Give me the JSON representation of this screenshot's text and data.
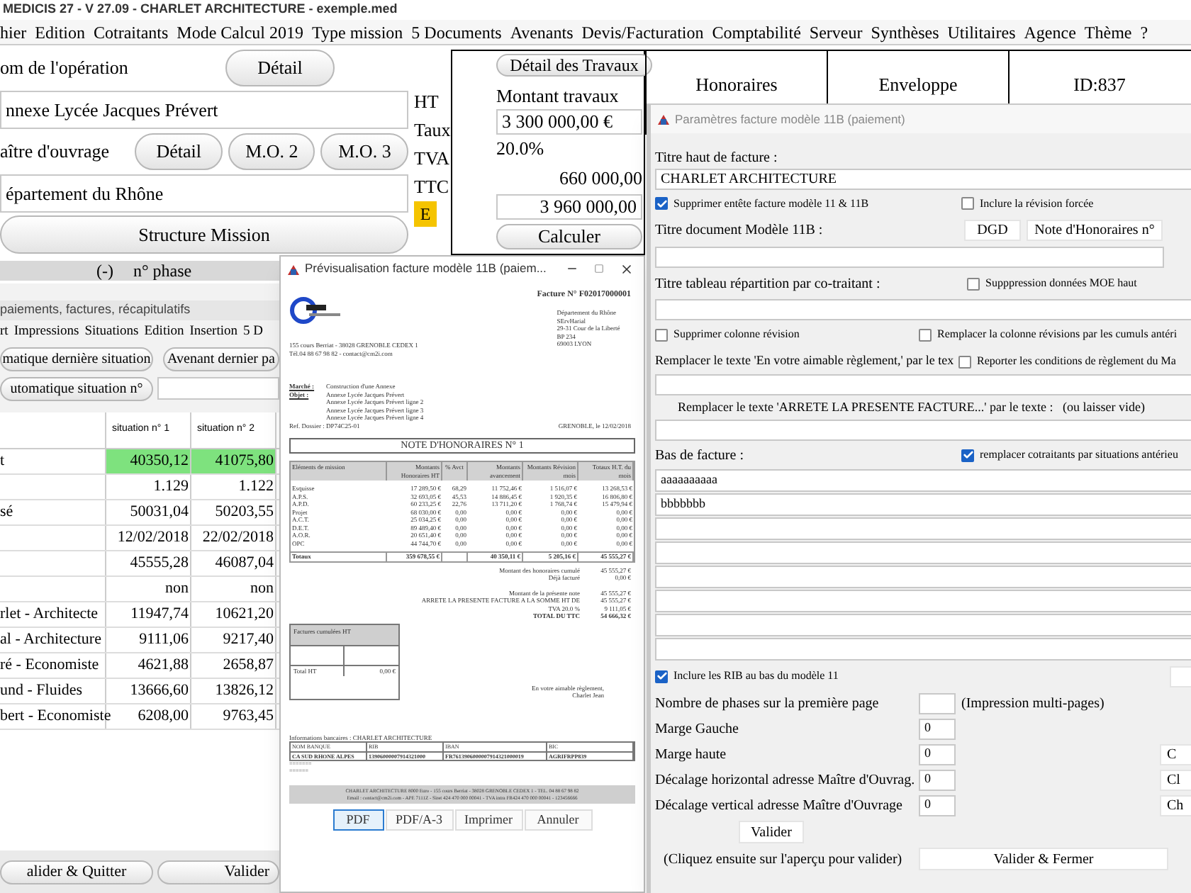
{
  "window": {
    "title": "MEDICIS 27  - V 27.09 - CHARLET ARCHITECTURE - exemple.med"
  },
  "menu": [
    "hier",
    "Edition",
    "Cotraitants",
    "Mode Calcul 2019",
    "Type mission",
    "5 Documents",
    "Avenants",
    "Devis/Facturation",
    "Comptabilité",
    "Serveur",
    "Synthèses",
    "Utilitaires",
    "Agence",
    "Thème",
    "?"
  ],
  "operation": {
    "label": "om de l'opération",
    "detail_button": "Détail",
    "name": "nnexe Lycée Jacques Prévert"
  },
  "owner": {
    "label": "aître d'ouvrage",
    "buttons": [
      "Détail",
      "M.O. 2",
      "M.O. 3"
    ],
    "name": "épartement du Rhône"
  },
  "structure_button": "Structure Mission",
  "phase_header": [
    "(-)",
    "n° phase"
  ],
  "amount_labels": [
    "HT",
    "Taux",
    "TVA",
    "TTC"
  ],
  "badge": "E",
  "works": {
    "detail_button": "Détail des Travaux",
    "label": "Montant travaux",
    "amount": "3 300 000,00 €",
    "rate": "20.0%",
    "vat": "660 000,00",
    "total": "3 960 000,00",
    "calc_button": "Calculer"
  },
  "summary_columns": [
    "Honoraires",
    "Enveloppe",
    "ID:837"
  ],
  "payments_window": {
    "title": "paiements, factures, récapitulatifs",
    "menu": [
      "rt",
      "Impressions",
      "Situations",
      "Edition",
      "Insertion",
      "5 D"
    ],
    "buttons": [
      "matique dernière situation",
      "Avenant dernier pa",
      "utomatique situation n°"
    ],
    "columns": [
      "situation n° 1",
      "situation n° 2"
    ],
    "rows": [
      {
        "label": "t",
        "values": [
          "40350,12",
          "41075,80"
        ],
        "highlighted": true
      },
      {
        "values": [
          "1.129",
          "1.122"
        ],
        "highlighted": false
      },
      {
        "label": "sé",
        "values": [
          "50031,04",
          "50203,55"
        ],
        "highlighted": false
      },
      {
        "values": [
          "12/02/2018",
          "22/02/2018"
        ],
        "highlighted": false
      },
      {
        "values": [
          "45555,28",
          "46087,04"
        ],
        "highlighted": false
      },
      {
        "values": [
          "non",
          "non"
        ],
        "highlighted": false
      },
      {
        "label": "rlet - Architecte",
        "values": [
          "11947,74",
          "10621,20"
        ],
        "highlighted": false
      },
      {
        "label": "al - Architecture",
        "values": [
          "9111,06",
          "9217,40"
        ],
        "highlighted": false
      },
      {
        "label": "ré - Economiste",
        "values": [
          "4621,88",
          "2658,87"
        ],
        "highlighted": false
      },
      {
        "label": "und - Fluides",
        "values": [
          "13666,60",
          "13826,12"
        ],
        "highlighted": false
      },
      {
        "label": "bert - Economiste",
        "values": [
          "6208,00",
          "9763,45"
        ],
        "highlighted": false
      }
    ],
    "bottom_buttons": [
      "alider & Quitter",
      "Valider"
    ]
  },
  "preview_window": {
    "title": "Prévisualisation facture modèle 11B (paiem...",
    "invoice": {
      "number": "Facture N° F02017000001",
      "client_lines": [
        "Département du Rhône",
        "SErvHarial",
        "29-31 Cour de la Liberté",
        "BP 234",
        "69003 LYON"
      ],
      "sender_lines": [
        "155 cours Berriat - 38028 GRENOBLE CEDEX 1",
        "Tél.04 88 67 98 82 - contact@cm2i.com"
      ],
      "market_label": "Marché :",
      "market": "Construction d'une Annexe",
      "object_label": "Objet :",
      "object_lines": [
        "Annexe Lycée Jacques Prévert",
        "Annexe Lycée Jacques Prévert ligne 2",
        "Annexe Lycée Jacques Prévert ligne 3",
        "Annexe Lycée Jacques Prévert ligne 4"
      ],
      "ref": "Ref. Dossier : DP74C25-01",
      "date": "GRENOBLE, le 12/02/2018",
      "title": "NOTE D'HONORAIRES N° 1",
      "columns": [
        "Eléments de mission",
        "Montants Honoraires HT",
        "% Avct",
        "Montants avancement",
        "Montants Révision mois",
        "Totaux H.T. du mois"
      ],
      "rows": [
        [
          "Esquisse",
          "17 289,50 €",
          "68,29",
          "11 752,46 €",
          "1 516,07 €",
          "13 268,53 €"
        ],
        [
          "A.P.S.",
          "32 693,05 €",
          "45,53",
          "14 886,45 €",
          "1 920,35 €",
          "16 806,80 €"
        ],
        [
          "A.P.D.",
          "60 233,25 €",
          "22,76",
          "13 711,20 €",
          "1 768,74 €",
          "15 479,94 €"
        ],
        [
          "Projet",
          "68 030,00 €",
          "0,00",
          "0,00 €",
          "0,00 €",
          "0,00 €"
        ],
        [
          "A.C.T.",
          "25 034,25 €",
          "0,00",
          "0,00 €",
          "0,00 €",
          "0,00 €"
        ],
        [
          "D.E.T.",
          "89 489,40 €",
          "0,00",
          "0,00 €",
          "0,00 €",
          "0,00 €"
        ],
        [
          "A.O.R.",
          "20 651,40 €",
          "0,00",
          "0,00 €",
          "0,00 €",
          "0,00 €"
        ],
        [
          "OPC",
          "44 744,70 €",
          "0,00",
          "0,00 €",
          "0,00 €",
          "0,00 €"
        ]
      ],
      "totals": {
        "label": "Totaux",
        "fees": "359 678,55 €",
        "progress_amount": "40 350,11 €",
        "revision": "5 205,16 €",
        "month_total": "45 555,27 €"
      },
      "summary_groups": [
        [
          {
            "label": "Montant des honoraires cumulé",
            "value": "45 555,27 €",
            "bold": false
          },
          {
            "label": "Déjà facturé",
            "value": "0,00 €",
            "bold": false
          }
        ],
        [
          {
            "label": "Montant de la présente note",
            "value": "45 555,27 €",
            "bold": false
          },
          {
            "label": "ARRETE LA PRESENTE FACTURE A LA SOMME HT DE",
            "value": "45 555,27 €",
            "bold": false
          },
          {
            "label": "TVA 20.0 %",
            "value": "9 111,05 €",
            "bold": false
          },
          {
            "label": "TOTAL DU TTC",
            "value": "54 666,32 €",
            "bold": true
          }
        ]
      ],
      "cumulated": {
        "title": "Factures cumulées HT",
        "total_label": "Total HT",
        "total": "0,00 €"
      },
      "signature": [
        "En votre aimable règlement,",
        "Charlet Jean"
      ],
      "bank_title": "Informations bancaires : CHARLET ARCHITECTURE",
      "bank_columns": [
        "NOM BANQUE",
        "RIB",
        "IBAN",
        "BIC"
      ],
      "bank_row": [
        "CA SUD RHONE ALPES",
        "13906000007914321000",
        "FR7613906000007914321000019",
        "AGRIFRPP839"
      ],
      "bank_notes": [
        "=======",
        "======"
      ],
      "footer": [
        "CHARLET ARCHITECTURE 8000 Euro - 155 cours Berriat - 38028 GRENOBLE CEDEX 1 - TEL. 04 88 67 98 82",
        "Email : contact@cm2i.com - APE 7111Z - Siret 424 470 000 00041 - TVA intra FR424 470 000 00041 - 123456666"
      ]
    },
    "buttons": [
      {
        "label": "PDF",
        "selected": true
      },
      {
        "label": "PDF/A-3",
        "selected": false
      },
      {
        "label": "Imprimer",
        "selected": false
      },
      {
        "label": "Annuler",
        "selected": false
      }
    ]
  },
  "params_window": {
    "title": "Paramètres facture modèle 11B (paiement)",
    "header_label": "Titre haut de facture :",
    "header_value": "CHARLET ARCHITECTURE",
    "remove_header": {
      "label": "Supprimer entête facture modèle 11 & 11B",
      "checked": true
    },
    "forced_revision": {
      "label": "Inclure la révision forcée",
      "checked": false
    },
    "doc_title_label": "Titre document Modèle 11B :",
    "doc_title_buttons": [
      "DGD",
      "Note d'Honoraires n°"
    ],
    "split_title_label": "Titre tableau répartition par co-traitant :",
    "remove_moe": {
      "label": "Supppression données MOE haut",
      "checked": false
    },
    "remove_revision": {
      "label": "Supprimer colonne révision",
      "checked": false
    },
    "replace_revision": {
      "label": "Remplacer la colonne révisions par les cumuls antéri",
      "checked": false
    },
    "replace_text_label": "Remplacer le texte 'En votre aimable règlement,' par le tex",
    "report_conditions": {
      "label": "Reporter les conditions de règlement du Ma",
      "checked": false
    },
    "arrete_label": "Remplacer le texte 'ARRETE LA PRESENTE FACTURE...' par le texte :   (ou laisser vide)",
    "footer_label": "Bas de facture :",
    "replace_cotraitants": {
      "label": "remplacer cotraitants par situations antérieu",
      "checked": true
    },
    "footer_lines": [
      "aaaaaaaaaa",
      "bbbbbbb"
    ],
    "include_rib": {
      "label": "Inclure les RIB au bas du modèle 11",
      "checked": true
    },
    "phases_label": "Nombre de phases sur la première page",
    "phases_note": "(Impression multi-pages)",
    "margins": [
      {
        "label": "Marge Gauche",
        "value": "0"
      },
      {
        "label": "Marge haute",
        "value": "0",
        "button": "C"
      },
      {
        "label": "Décalage horizontal adresse Maître d'Ouvrag.",
        "value": "0",
        "button": "Cl"
      },
      {
        "label": "Décalage vertical adresse Maître d'Ouvrage",
        "value": "0",
        "button": "Ch"
      }
    ],
    "validate_button": "Valider",
    "hint": "(Cliquez ensuite sur l'aperçu pour valider)",
    "close_button": "Valider & Fermer"
  }
}
